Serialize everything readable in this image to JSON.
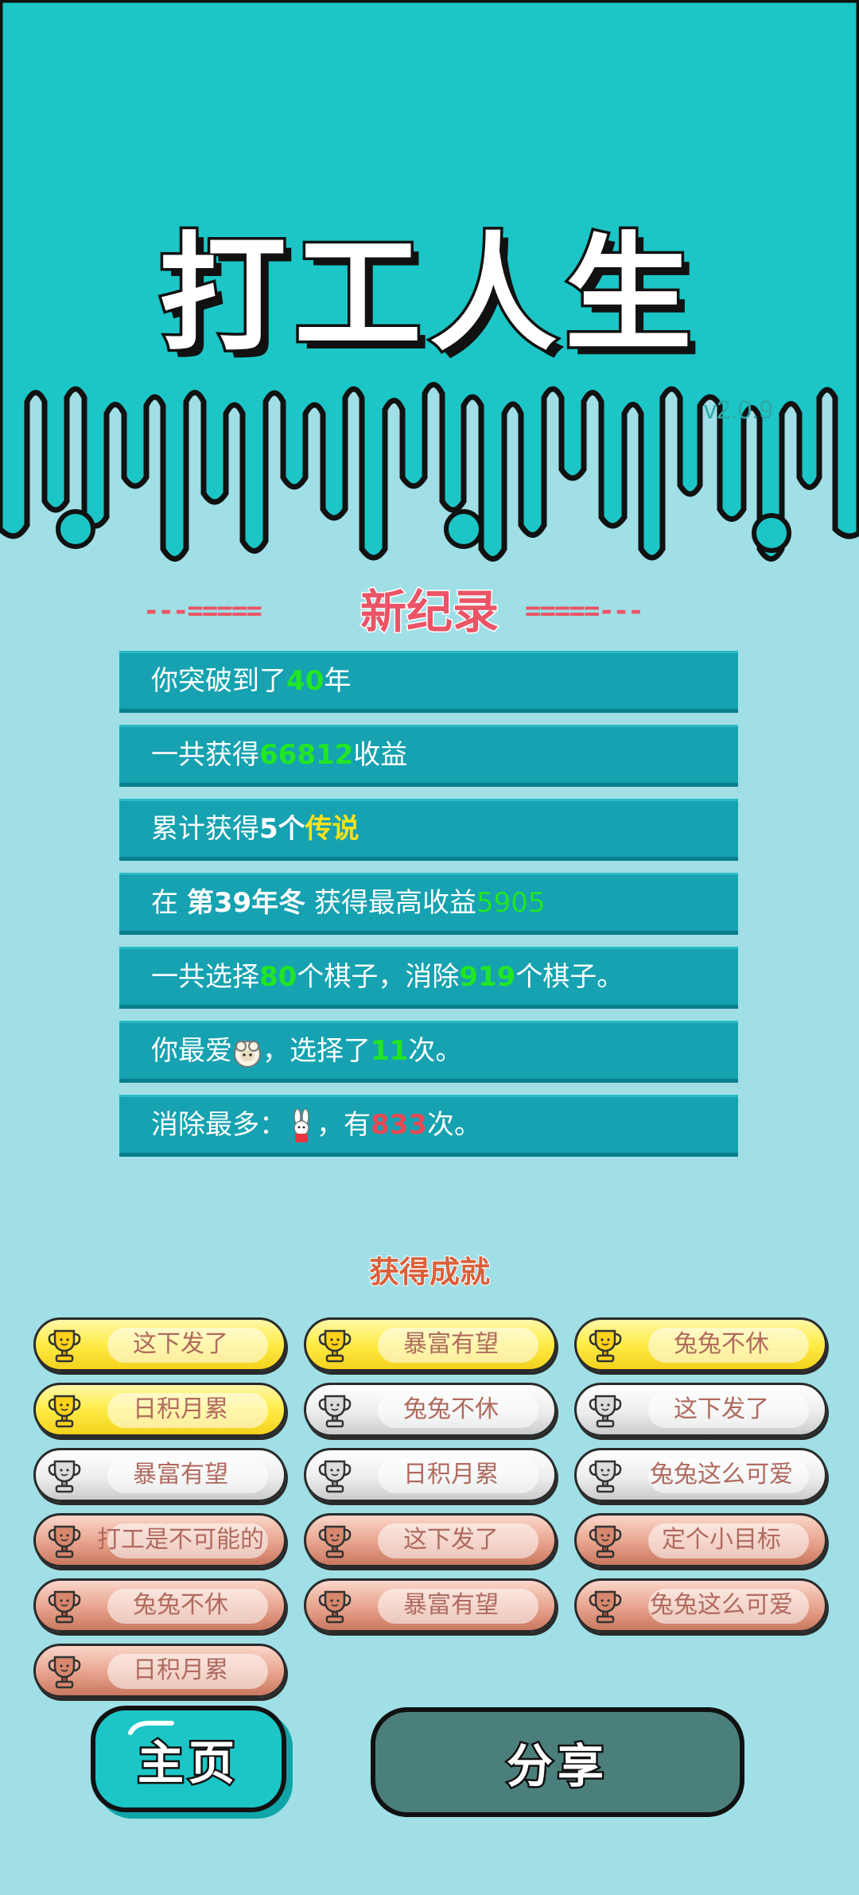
{
  "game": {
    "title": "打工人生",
    "version": "v2.0.9"
  },
  "record": {
    "heading": "新纪录",
    "deco_left": "---=====",
    "deco_right": "=====---",
    "lines": [
      {
        "a": "你突破到了",
        "b": "40",
        "c": "年"
      },
      {
        "a": "一共获得",
        "b": "66812",
        "c": "收益"
      },
      {
        "a": "累计获得",
        "b": "5个",
        "c": "传说"
      },
      {
        "a": "在 ",
        "b": "第39年冬",
        "c": " 获得最高收益",
        "d": "5905"
      },
      {
        "a": "一共选择",
        "b": "80",
        "c": "个棋子，消除",
        "d": "919",
        "e": "个棋子。"
      },
      {
        "a": "你最爱",
        "b": "，选择了",
        "c": "11",
        "d": "次。"
      },
      {
        "a": "消除最多：",
        "b": "，有",
        "c": "833",
        "d": "次。"
      }
    ]
  },
  "achievements": {
    "heading": "获得成就",
    "items": [
      {
        "label": "这下发了",
        "tier": "gold"
      },
      {
        "label": "暴富有望",
        "tier": "gold"
      },
      {
        "label": "兔兔不休",
        "tier": "gold"
      },
      {
        "label": "日积月累",
        "tier": "gold"
      },
      {
        "label": "兔兔不休",
        "tier": "silver"
      },
      {
        "label": "这下发了",
        "tier": "silver"
      },
      {
        "label": "暴富有望",
        "tier": "silver"
      },
      {
        "label": "日积月累",
        "tier": "silver"
      },
      {
        "label": "兔兔这么可爱",
        "tier": "silver"
      },
      {
        "label": "打工是不可能的",
        "tier": "bronze"
      },
      {
        "label": "这下发了",
        "tier": "bronze"
      },
      {
        "label": "定个小目标",
        "tier": "bronze"
      },
      {
        "label": "兔兔不休",
        "tier": "bronze"
      },
      {
        "label": "暴富有望",
        "tier": "bronze"
      },
      {
        "label": "兔兔这么可爱",
        "tier": "bronze"
      },
      {
        "label": "日积月累",
        "tier": "bronze"
      }
    ]
  },
  "buttons": {
    "home": "主页",
    "share": "分享"
  },
  "icons": {
    "sheep": "sheep-icon",
    "rabbit": "rabbit-icon",
    "trophy": "trophy-icon"
  },
  "colors": {
    "background": "#a0dfe6",
    "header": "#1cc6c6",
    "row": "#16a2b1",
    "highlight_green": "#21e624",
    "highlight_yellow": "#ffe21a",
    "highlight_red": "#ea4a55",
    "record": "#ea5466"
  }
}
